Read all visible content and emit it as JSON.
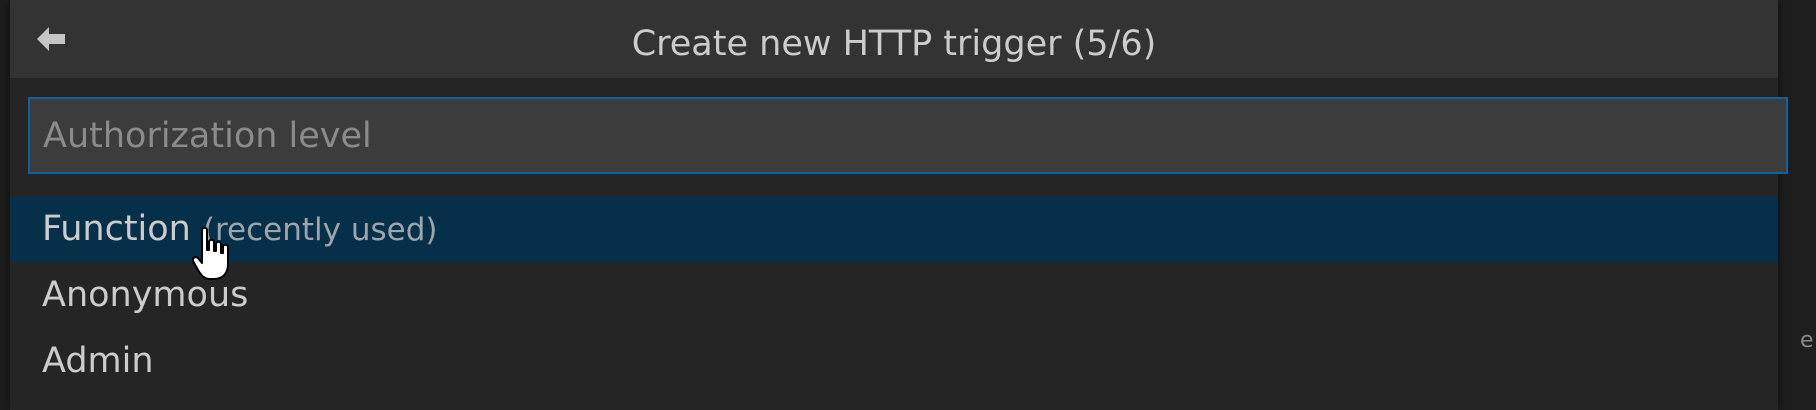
{
  "quick_pick": {
    "title": "Create new HTTP trigger (5/6)",
    "back_icon": "arrow-left-icon",
    "input": {
      "value": "",
      "placeholder": "Authorization level"
    },
    "items": [
      {
        "label": "Function",
        "description": "(recently used)",
        "selected": true
      },
      {
        "label": "Anonymous",
        "description": "",
        "selected": false
      },
      {
        "label": "Admin",
        "description": "",
        "selected": false
      }
    ]
  },
  "edge_glyph": "e",
  "colors": {
    "title_bar": "#333333",
    "panel": "#252526",
    "input_bg": "#3c3c3c",
    "focus_border": "#0e639c",
    "selected_row": "#062f4a",
    "text": "#cccccc"
  },
  "pointer_icon": "hand-pointer-icon"
}
